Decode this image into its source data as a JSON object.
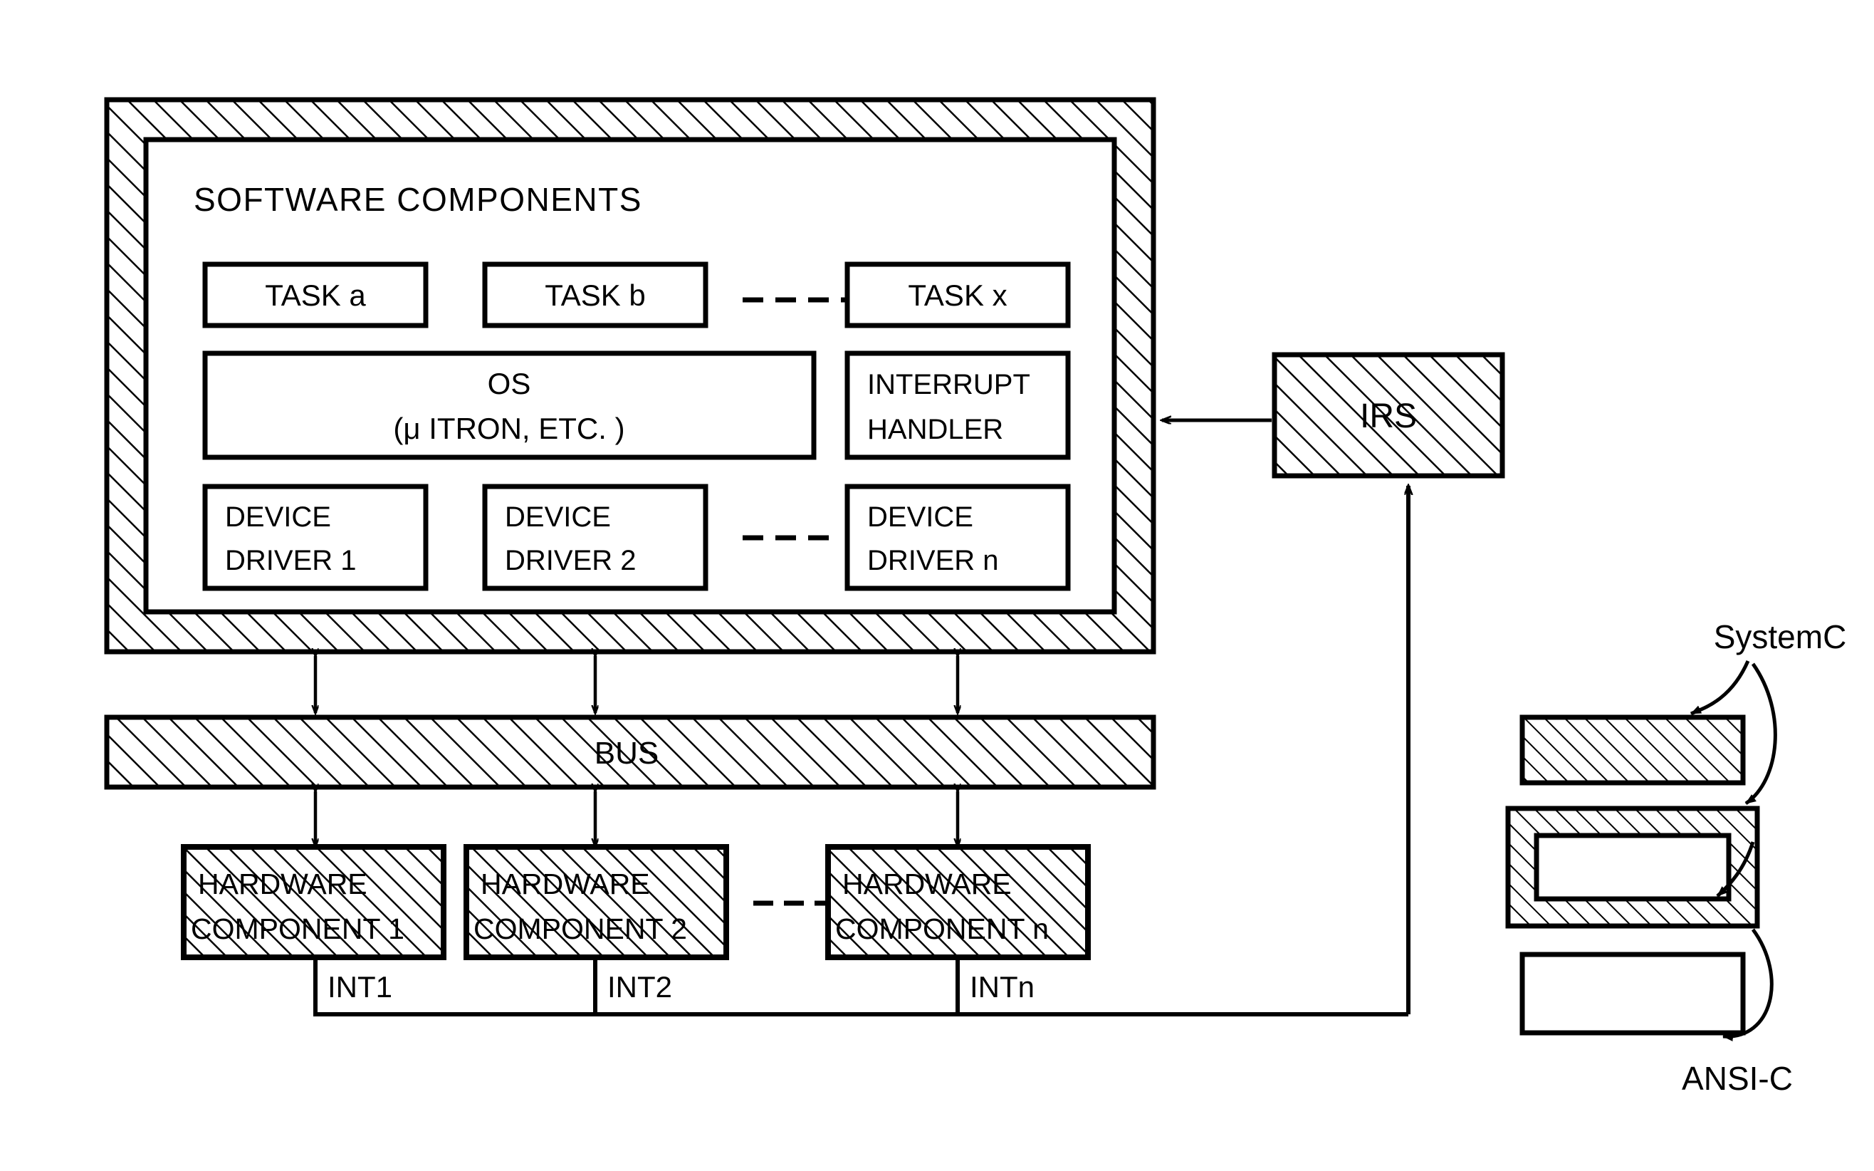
{
  "diagram": {
    "title": "Embedded system architecture with SystemC / ANSI-C partitioning",
    "software_block": {
      "heading": "SOFTWARE COMPONENTS",
      "tasks": [
        {
          "label": "TASK a"
        },
        {
          "label": "TASK b"
        },
        {
          "label": "TASK x"
        }
      ],
      "task_ellipsis": "- - - -",
      "os": {
        "line1": "OS",
        "line2": "(μ ITRON, ETC. )"
      },
      "interrupt_handler": {
        "line1": "INTERRUPT",
        "line2": "HANDLER"
      },
      "device_drivers": [
        {
          "line1": "DEVICE",
          "line2": "DRIVER 1"
        },
        {
          "line1": "DEVICE",
          "line2": "DRIVER 2"
        },
        {
          "line1": "DEVICE",
          "line2": "DRIVER n"
        }
      ],
      "driver_ellipsis": "- - - -"
    },
    "bus": {
      "label": "BUS"
    },
    "hardware_components": [
      {
        "line1": "HARDWARE",
        "line2": "COMPONENT 1",
        "interrupt": "INT1"
      },
      {
        "line1": "HARDWARE",
        "line2": "COMPONENT 2",
        "interrupt": "INT2"
      },
      {
        "line1": "HARDWARE",
        "line2": "COMPONENT n",
        "interrupt": "INTn"
      }
    ],
    "hardware_ellipsis": "- - - -",
    "irs": {
      "label": "IRS"
    },
    "legend": {
      "systemc_label": "SystemC",
      "ansic_label": "ANSI-C"
    },
    "colors": {
      "ink": "#000000",
      "paper": "#ffffff"
    }
  }
}
